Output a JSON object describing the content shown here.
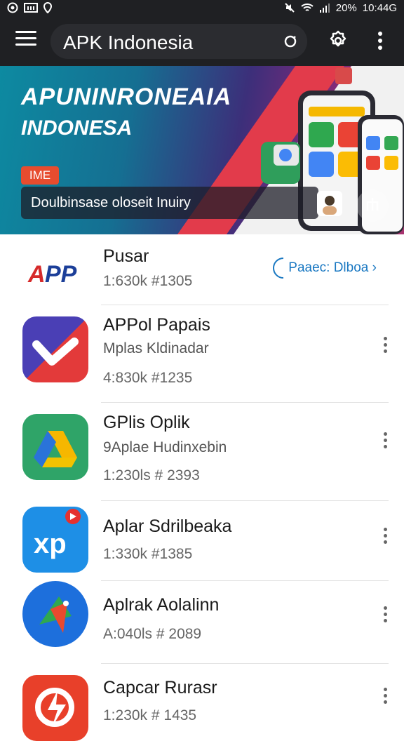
{
  "status_bar": {
    "left_icons": [
      "whatsapp-icon",
      "gallery-icon",
      "location-icon"
    ],
    "battery": "20%",
    "time": "10:44G"
  },
  "app_bar": {
    "search_text": "APK Indonesia",
    "icons": [
      "menu-icon",
      "search-icon",
      "settings-icon",
      "more-vert-icon"
    ]
  },
  "banner": {
    "title_line1": "APUNINRONEAIA",
    "title_line2": "INDONESA",
    "badge": "IME",
    "caption": "Doulbinsase oloseit Inuiry",
    "colors": {
      "teal": "#0d8aa1",
      "purple": "#3c2f7a",
      "red": "#e23b4b"
    }
  },
  "apps": [
    {
      "name": "Pusar",
      "stats": "1:630k  #1305",
      "action_label": "Paaec:  Dlboa",
      "icon": "app-logo"
    },
    {
      "name": "APPol Papais",
      "subtitle": "Mplas Kldinadar",
      "stats": "4:830k  #1235",
      "icon": "v-check-logo"
    },
    {
      "name": "GPlis Oplik",
      "subtitle": "9Aplae Hudinxebin",
      "stats": "1:230ls  # 2393",
      "icon": "drive-logo"
    },
    {
      "name": "Aplar Sdrilbeaka",
      "stats": "1:330k  #1385",
      "icon": "xp-logo"
    },
    {
      "name": "Aplrak Aolalinn",
      "stats": "A:040ls  # 2089",
      "icon": "bird-logo"
    },
    {
      "name": "Capcar Rurasr",
      "stats": "1:230k  # 1435",
      "icon": "flash-logo"
    }
  ]
}
